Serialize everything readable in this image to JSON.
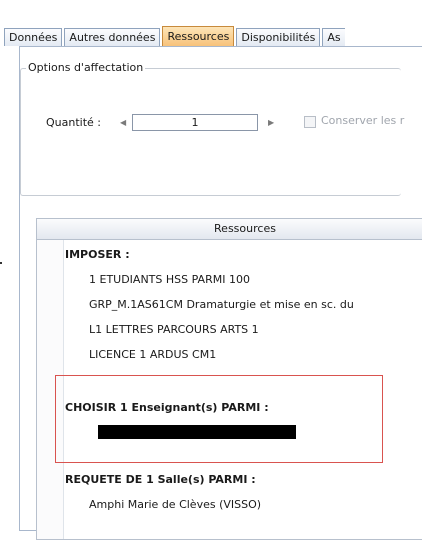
{
  "tabs": [
    {
      "label": "Données",
      "active": false
    },
    {
      "label": "Autres données",
      "active": false
    },
    {
      "label": "Ressources",
      "active": true
    },
    {
      "label": "Disponibilités",
      "active": false
    },
    {
      "label": "As",
      "active": false
    }
  ],
  "assignment_options": {
    "legend": "Options d'affectation",
    "quantity_label": "Quantité :",
    "quantity_value": "1",
    "keep_label": "Conserver les r",
    "keep_checked": false
  },
  "resources": {
    "header": "Ressources",
    "impose_label": "IMPOSER :",
    "impose_items": [
      "1 ETUDIANTS HSS PARMI 100",
      "GRP_M.1AS61CM Dramaturgie et mise en sc. du",
      "L1 LETTRES PARCOURS ARTS 1",
      "LICENCE 1 ARDUS CM1"
    ],
    "choose_label": "CHOISIR 1 Enseignant(s) PARMI :",
    "request_label": "REQUETE DE 1 Salle(s) PARMI :",
    "request_items": [
      "Amphi Marie de Clèves (VISSO)"
    ]
  },
  "colors": {
    "active_tab": "#f7c27a",
    "highlight_border": "#d9534f"
  }
}
